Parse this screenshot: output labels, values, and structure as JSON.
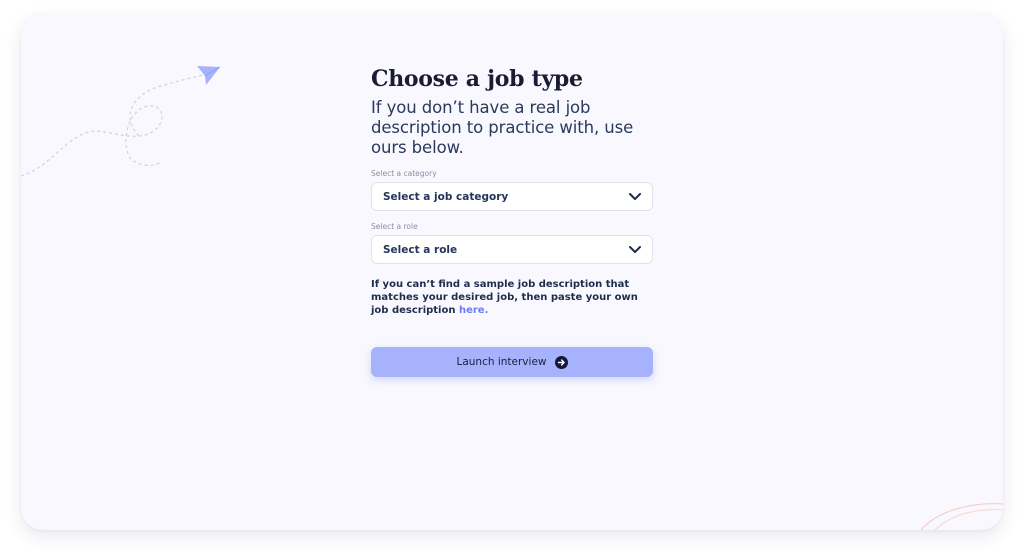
{
  "page": {
    "title": "Choose a job type",
    "subtitle": "If you don’t have a real job description to practice with, use ours below."
  },
  "category_select": {
    "label": "Select a category",
    "value": "Select a job category",
    "icon": "chevron-down-icon"
  },
  "role_select": {
    "label": "Select a role",
    "value": "Select a role",
    "icon": "chevron-down-icon"
  },
  "help": {
    "text": "If you can’t find a sample job description that matches your desired job, then paste your own job description ",
    "link": "here."
  },
  "launch": {
    "label": "Launch interview",
    "icon": "arrow-right-circle-icon"
  },
  "colors": {
    "card_background": "#f8f8fe",
    "accent": "#a6b2fc",
    "link": "#6f7cf0",
    "heading": "#1a1c33"
  }
}
